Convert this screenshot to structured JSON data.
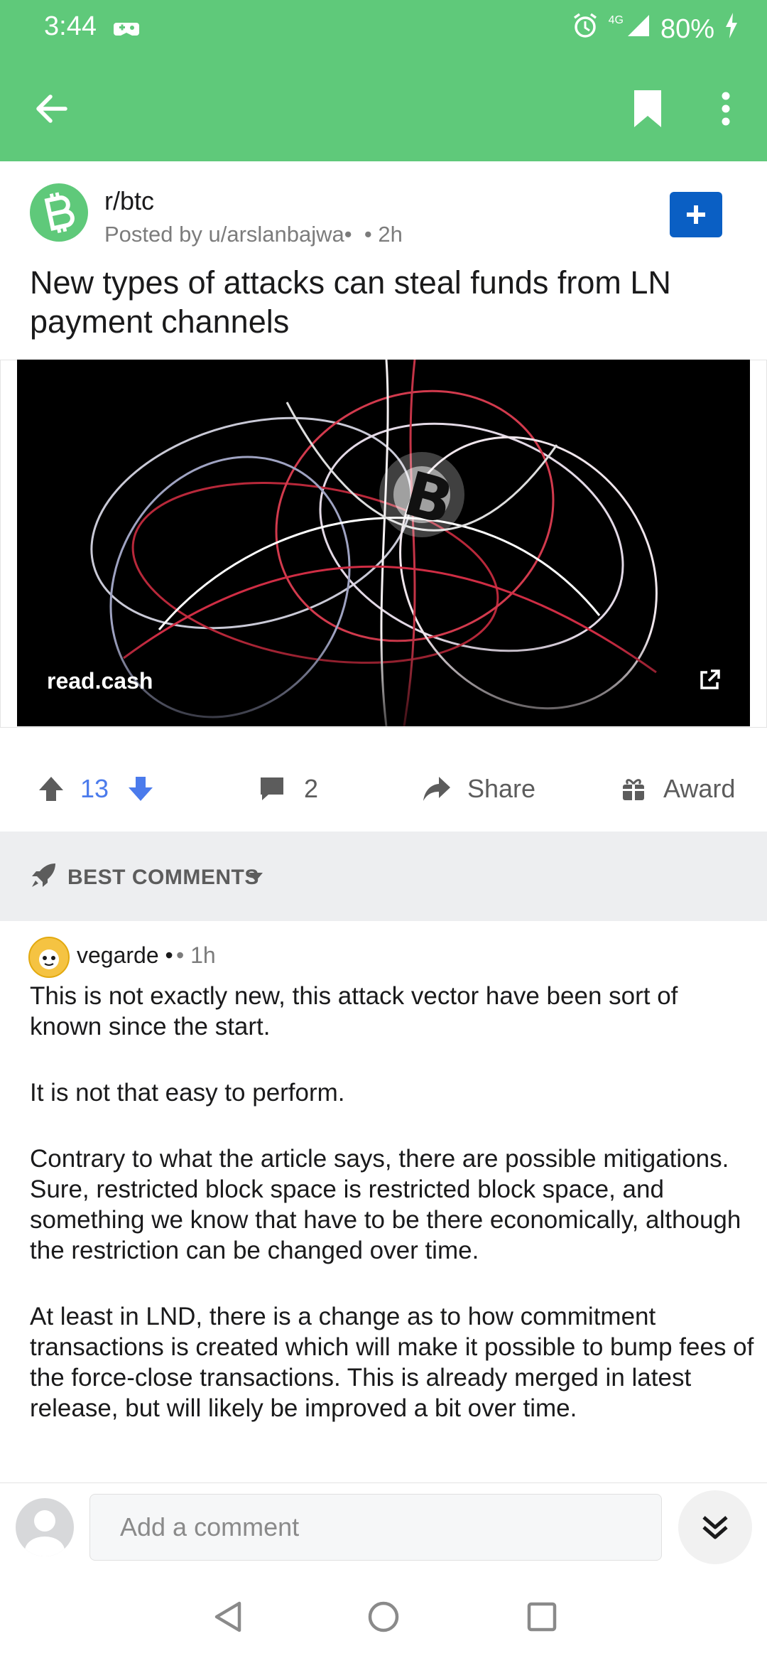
{
  "status_bar": {
    "time": "3:44",
    "network": "4G",
    "battery": "80%",
    "icons": [
      "game-controller-icon",
      "alarm-icon",
      "signal-icon",
      "charging-icon"
    ]
  },
  "app_bar": {
    "icons": [
      "back-arrow-icon",
      "bookmark-icon",
      "more-vert-icon"
    ]
  },
  "post": {
    "subreddit": "r/btc",
    "posted_by": "Posted by u/arslanbajwa•",
    "time": "• 2h",
    "title": "New types of attacks can steal funds from LN payment channels",
    "link_domain": "read.cash",
    "votes": "13",
    "comments_count": "2",
    "share_label": "Share",
    "award_label": "Award"
  },
  "comments_header": {
    "sort_label": "BEST COMMENTS"
  },
  "comment": {
    "author": "vegarde •",
    "time": "• 1h",
    "paragraphs": [
      "This is not exactly new, this attack vector have been sort of known since the start.",
      "It is not that easy to perform.",
      "Contrary to what the article says, there are possible mitigations. Sure, restricted block space is restricted block space, and something we know that have to be there economically, although the restriction can be changed over time.",
      "At least in LND, there is a change as to how commitment transactions is created which will make it possible to bump fees of the force-close transactions. This is already merged in latest release, but will likely be improved a bit over time."
    ]
  },
  "composer": {
    "placeholder": "Add a comment"
  },
  "colors": {
    "brand_green": "#5fc97a",
    "join_blue": "#0a5fc4",
    "upvote_blue": "#4b7bec"
  }
}
